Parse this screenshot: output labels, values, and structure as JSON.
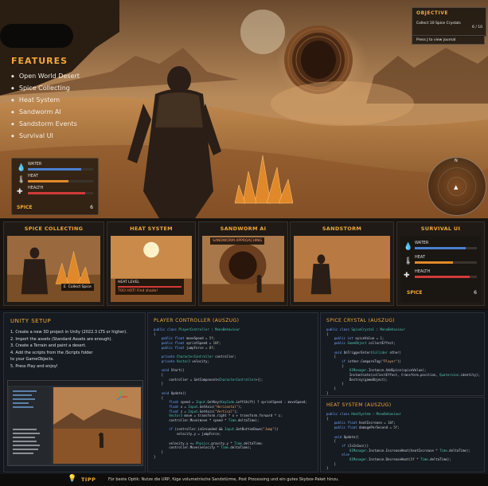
{
  "features": {
    "title": "FEATURES",
    "items": [
      "Open World Desert",
      "Spice Collecting",
      "Heat System",
      "Sandworm AI",
      "Sandstorm Events",
      "Survival UI"
    ]
  },
  "hud": {
    "water_label": "WATER",
    "heat_label": "HEAT",
    "health_label": "HEALTH",
    "water_level": 0.82,
    "heat_level": 0.62,
    "health_level": 0.88,
    "spice_label": "SPICE",
    "spice_value": "6"
  },
  "objective": {
    "title": "OBJECTIVE",
    "desc": "Collect 10 Spice Crystals",
    "count": "6 / 10",
    "journal": "Press J to view journal"
  },
  "minimap": {
    "north": "N"
  },
  "panels": [
    {
      "title": "SPICE COLLECTING",
      "caption_key": "E",
      "caption": "Collect Spice"
    },
    {
      "title": "HEAT SYSTEM",
      "caption": "HEAT LEVEL",
      "caption2": "TOO HOT! Find shade!"
    },
    {
      "title": "SANDWORM AI",
      "caption": "SANDWORM APPROACHING"
    },
    {
      "title": "SANDSTORM"
    },
    {
      "title": "SURVIVAL UI"
    }
  ],
  "setup": {
    "title": "UNITY SETUP",
    "steps": [
      "1. Create a new 3D project in Unity (2022.3 LTS or higher).",
      "2. Import the assets (Standard Assets are enough).",
      "3. Create a Terrain and paint a desert.",
      "4. Add the scripts from the /Scripts folder",
      "    to your GameObjects.",
      "5. Press Play and enjoy!"
    ]
  },
  "code": {
    "player_title": "PLAYER CONTROLLER (AUSZUG)",
    "spice_title": "SPICE CRYSTAL (AUSZUG)",
    "heat_title": "HEAT SYSTEM (AUSZUG)"
  },
  "tip": {
    "label": "TIPP",
    "text": "Für beste Optik: Nutze die URP, füge volumetrische Sandstürme, Post Processing und ein gutes Skybox-Paket hinzu."
  },
  "colors": {
    "accent": "#f0a93b",
    "water": "#4a7fd0",
    "heat": "#e08a2a",
    "health": "#d23a3a"
  }
}
